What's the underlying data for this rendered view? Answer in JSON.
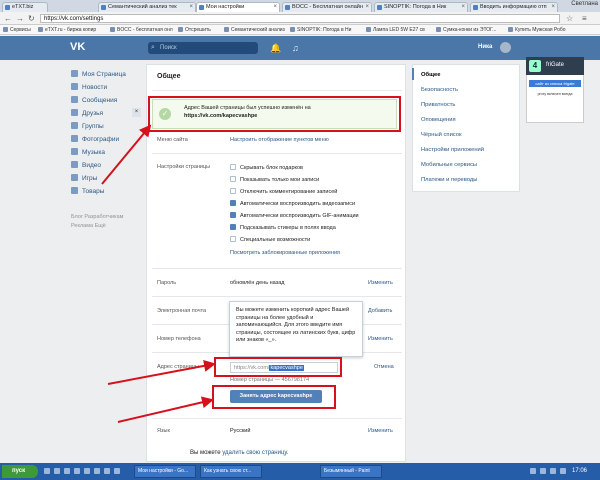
{
  "browser": {
    "tabs": [
      {
        "label": "eTXT.biz"
      },
      {
        "label": "Семантический анализ тек"
      },
      {
        "label": "Мои настройки"
      },
      {
        "label": "BOCC - Бесплатная онлайн"
      },
      {
        "label": "SINOPTIK: Погода в Ник"
      },
      {
        "label": "Вводить информацию отп"
      }
    ],
    "window_label": "Светлана",
    "url": "https://vk.com/settings",
    "bookmarks": [
      "Сервисы",
      "eTXT.ru - биржа копир",
      "BOCC - бесплатная онл",
      "Отсрешить",
      "Семантический анализ",
      "SINOPTIK: Погода в Ни",
      "Лампа LED 5W E27 св",
      "Сумка-конки из ЭТОГ...",
      "Купить Мужская Робо"
    ]
  },
  "vk_header": {
    "logo": "VK",
    "search_placeholder": "Поиск",
    "user_name": "Ника"
  },
  "left_menu": {
    "items": [
      {
        "label": "Моя Страница"
      },
      {
        "label": "Новости"
      },
      {
        "label": "Сообщения"
      },
      {
        "label": "Друзья"
      },
      {
        "label": "Группы"
      },
      {
        "label": "Фотографии"
      },
      {
        "label": "Музыка"
      },
      {
        "label": "Видео"
      },
      {
        "label": "Игры"
      },
      {
        "label": "Товары"
      }
    ],
    "footer_line1": "Блог   Разработчикам",
    "footer_line2": "Реклама   Ещё"
  },
  "main": {
    "title": "Общее",
    "alert": {
      "text": "Адрес Вашей страницы был успешно изменён на",
      "url": "https://vk.com/kapecvashpe"
    },
    "menu_site": {
      "label": "Меню сайта",
      "link": "Настроить отображение пунктов меню"
    },
    "page_settings": {
      "label": "Настройки страницы",
      "options": [
        {
          "label": "Скрывать блок подарков",
          "checked": false
        },
        {
          "label": "Показывать только мои записи",
          "checked": false
        },
        {
          "label": "Отключить комментирование записей",
          "checked": false
        },
        {
          "label": "Автоматически воспроизводить видеозаписи",
          "checked": true
        },
        {
          "label": "Автоматически воспроизводить GIF-анимации",
          "checked": true
        },
        {
          "label": "Подсказывать стикеры в полях ввода",
          "checked": true
        },
        {
          "label": "Специальные возможности",
          "checked": false
        }
      ],
      "blocked_link": "Посмотреть заблокированные приложения"
    },
    "password": {
      "label": "Пароль",
      "value": "обновлён день назад",
      "action": "Изменить"
    },
    "email": {
      "label": "Электронная почта",
      "action": "Добавить"
    },
    "phone": {
      "label": "Номер телефона",
      "action": "Изменить"
    },
    "tooltip": "Вы можете изменить короткий адрес Вашей страницы на более удобный и запоминающийся. Для этого введите имя страницы, состоящее из латинских букв, цифр или знаков «_».",
    "address": {
      "label": "Адрес страницы",
      "prefix": "https://vk.com/",
      "value": "kapecvashpe",
      "cancel": "Отмена",
      "page_number": "Номер страницы — 456798174",
      "button": "Занять адрес kapecvashpe"
    },
    "language": {
      "label": "Язык",
      "value": "Русский",
      "action": "Изменить"
    },
    "delete": {
      "prefix": "Вы можете",
      "link": "удалить свою страницу."
    }
  },
  "right_menu": {
    "items": [
      {
        "label": "Общее",
        "active": true
      },
      {
        "label": "Безопасность"
      },
      {
        "label": "Приватность"
      },
      {
        "label": "Оповещения"
      },
      {
        "label": "Чёрный список"
      },
      {
        "label": "Настройки приложений"
      },
      {
        "label": "Мобильные сервисы"
      },
      {
        "label": "Платежи и переводы"
      }
    ]
  },
  "frigate": {
    "title": "friGate",
    "line1": "сайт из списка frigate",
    "line2": "proxy включен всегда"
  },
  "taskbar": {
    "start": "пуск",
    "tasks": [
      "Мои настройки - Go...",
      "Как узнать свою ст...",
      "Безымянный - Paint"
    ],
    "clock": "17:06"
  },
  "colors": {
    "vk_blue": "#4a76a8",
    "annotation_red": "#d6111b",
    "link": "#2a5885"
  }
}
